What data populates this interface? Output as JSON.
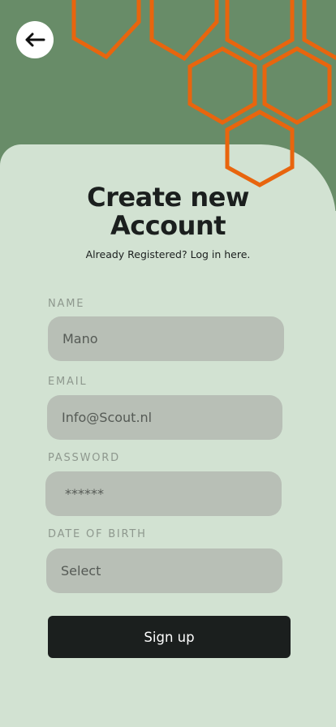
{
  "colors": {
    "header_bg": "#688c68",
    "page_bg": "#d2e2d2",
    "hex_accent": "#e8650e",
    "field_bg": "#b8bfb6",
    "button_bg": "#1b1f1e",
    "label_color": "#8e988e"
  },
  "header": {
    "back_icon": "arrow-left-icon",
    "decoration": "hexagon-pattern"
  },
  "title": {
    "line1": "Create new",
    "line2": "Account"
  },
  "subtitle": "Already Registered? Log in here.",
  "form": {
    "name": {
      "label": "NAME",
      "value": "Mano"
    },
    "email": {
      "label": "EMAIL",
      "value": "Info@Scout.nl"
    },
    "password": {
      "label": "PASSWORD",
      "value": "******"
    },
    "dob": {
      "label": "DATE OF BIRTH",
      "value": "Select"
    }
  },
  "signup_label": "Sign up"
}
